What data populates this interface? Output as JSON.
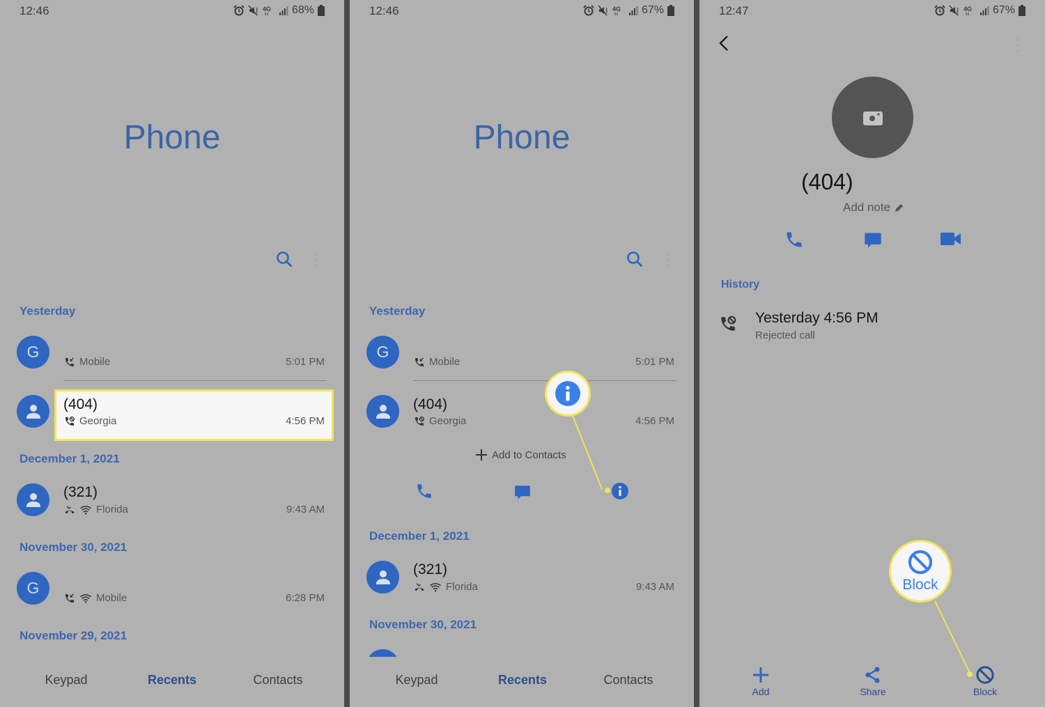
{
  "panels": [
    {
      "status": {
        "time": "12:46",
        "battery": "68%"
      },
      "title": "Phone",
      "sections": [
        {
          "header": "Yesterday"
        },
        {
          "header": "December 1, 2021"
        },
        {
          "header": "November 30, 2021"
        },
        {
          "header": "November 29, 2021"
        }
      ],
      "calls": [
        {
          "avatar": "G",
          "name": "",
          "sub": "Mobile",
          "time": "5:01 PM",
          "call_type": "incoming-call-icon"
        },
        {
          "avatar": "person",
          "name": "(404)",
          "sub": "Georgia",
          "time": "4:56 PM",
          "call_type": "rejected-call-icon",
          "highlighted": true
        },
        {
          "avatar": "person",
          "name": "(321)",
          "sub": "Florida",
          "time": "9:43 AM",
          "call_type": "missed-call-icon",
          "wifi": true
        },
        {
          "avatar": "G",
          "name": "",
          "sub": "Mobile",
          "time": "6:28 PM",
          "call_type": "incoming-call-icon",
          "wifi": true
        }
      ],
      "tabs": [
        {
          "label": "Keypad",
          "active": false
        },
        {
          "label": "Recents",
          "active": true
        },
        {
          "label": "Contacts",
          "active": false
        }
      ]
    },
    {
      "status": {
        "time": "12:46",
        "battery": "67%"
      },
      "title": "Phone",
      "sections": [
        {
          "header": "Yesterday"
        },
        {
          "header": "December 1, 2021"
        },
        {
          "header": "November 30, 2021"
        }
      ],
      "calls": [
        {
          "avatar": "G",
          "name": "",
          "sub": "Mobile",
          "time": "5:01 PM",
          "call_type": "incoming-call-icon"
        },
        {
          "avatar": "person",
          "name": "(404)",
          "sub": "Georgia",
          "time": "4:56 PM",
          "call_type": "rejected-call-icon",
          "expanded": true
        },
        {
          "avatar": "person",
          "name": "(321)",
          "sub": "Florida",
          "time": "9:43 AM",
          "call_type": "missed-call-icon",
          "wifi": true
        }
      ],
      "expanded_actions": {
        "add_to_contacts": "Add to Contacts",
        "buttons": [
          "call",
          "message",
          "details"
        ]
      },
      "tabs": [
        {
          "label": "Keypad",
          "active": false
        },
        {
          "label": "Recents",
          "active": true
        },
        {
          "label": "Contacts",
          "active": false
        }
      ]
    },
    {
      "status": {
        "time": "12:47",
        "battery": "67%"
      },
      "contact": {
        "name": "(404)",
        "add_note": "Add note",
        "quick_actions": [
          "call",
          "message",
          "video-call"
        ]
      },
      "history": {
        "header": "History",
        "entries": [
          {
            "time": "Yesterday 4:56 PM",
            "type": "Rejected call"
          }
        ]
      },
      "callout_label": "Block",
      "bottom_actions": [
        {
          "label": "Add",
          "icon": "plus-icon"
        },
        {
          "label": "Share",
          "icon": "share-icon"
        },
        {
          "label": "Block",
          "icon": "block-icon"
        }
      ]
    }
  ],
  "colors": {
    "accent": "#2e66c1",
    "header_blue": "#3d67ad",
    "background": "#b1b1b1",
    "highlight_border": "#f3e55a",
    "separator": "#4a4a4a"
  }
}
